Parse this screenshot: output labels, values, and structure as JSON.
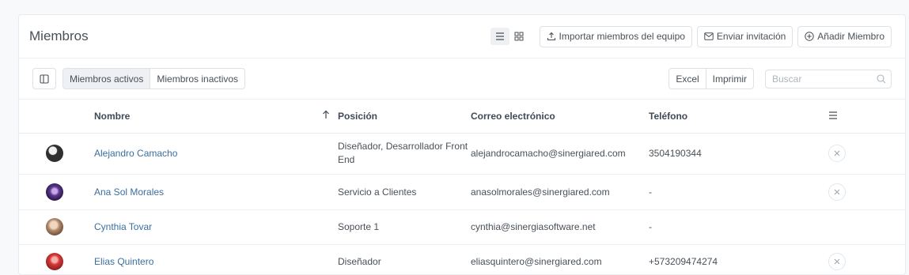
{
  "header": {
    "title": "Miembros",
    "import_label": "Importar miembros del equipo",
    "invite_label": "Enviar invitación",
    "add_label": "Añadir Miembro"
  },
  "toolbar": {
    "tabs": [
      "Miembros activos",
      "Miembros inactivos"
    ],
    "excel_label": "Excel",
    "print_label": "Imprimir",
    "search_placeholder": "Buscar"
  },
  "table": {
    "columns": [
      "Nombre",
      "Posición",
      "Correo electrónico",
      "Teléfono"
    ],
    "rows": [
      {
        "name": "Alejandro Camacho",
        "position": "Diseñador, Desarrollador Front End",
        "email": "alejandrocamacho@sinergiared.com",
        "phone": "3504190344",
        "avatar_color": "#2f2f2f"
      },
      {
        "name": "Ana Sol Morales",
        "position": "Servicio a Clientes",
        "email": "anasolmorales@sinergiared.com",
        "phone": "-",
        "avatar_color": "#5b3a8e"
      },
      {
        "name": "Cynthia Tovar",
        "position": "Soporte 1",
        "email": "cynthia@sinergiasoftware.net",
        "phone": "-",
        "avatar_color": "#b08a6a"
      },
      {
        "name": "Elias Quintero",
        "position": "Diseñador",
        "email": "eliasquintero@sinergiared.com",
        "phone": "+573209474274",
        "avatar_color": "#d63a3a"
      }
    ]
  },
  "colors": {
    "link": "#3b6e9e",
    "border": "#dee2e6",
    "active_bg": "#eef0f3"
  }
}
